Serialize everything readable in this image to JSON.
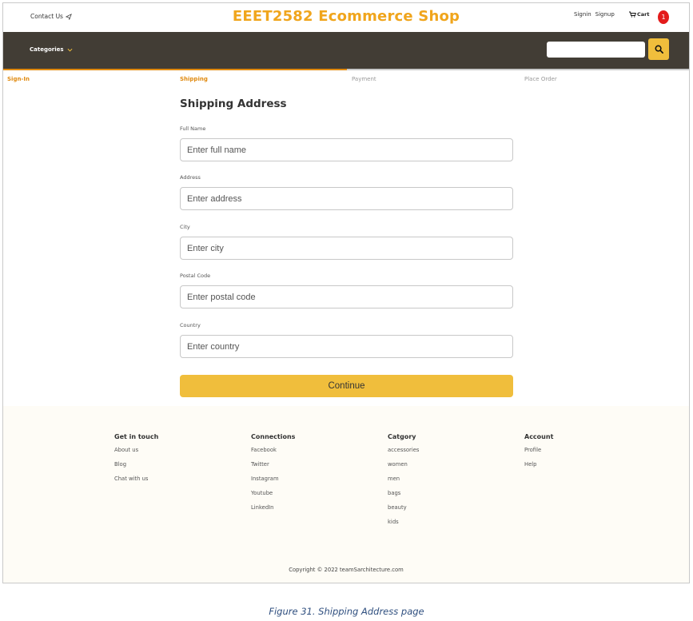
{
  "header": {
    "contact_label": "Contact Us",
    "brand": "EEET2582 Ecommerce Shop",
    "signin_label": "Signin",
    "signup_label": "Signup",
    "cart_label": "Cart",
    "cart_count": "1"
  },
  "nav": {
    "categories_label": "Categories",
    "search_placeholder": ""
  },
  "steps": [
    {
      "label": "Sign-In",
      "active": true
    },
    {
      "label": "Shipping",
      "active": true
    },
    {
      "label": "Payment",
      "active": false
    },
    {
      "label": "Place Order",
      "active": false
    }
  ],
  "form": {
    "title": "Shipping Address",
    "fields": [
      {
        "label": "Full Name",
        "placeholder": "Enter full name",
        "value": ""
      },
      {
        "label": "Address",
        "placeholder": "Enter address",
        "value": ""
      },
      {
        "label": "City",
        "placeholder": "Enter city",
        "value": ""
      },
      {
        "label": "Postal Code",
        "placeholder": "Enter postal code",
        "value": ""
      },
      {
        "label": "Country",
        "placeholder": "Enter country",
        "value": ""
      }
    ],
    "submit_label": "Continue"
  },
  "footer": {
    "columns": [
      {
        "title": "Get in touch",
        "items": [
          "About us",
          "Blog",
          "Chat with us"
        ]
      },
      {
        "title": "Connections",
        "items": [
          "Facebook",
          "Twitter",
          "Instagram",
          "Youtube",
          "LinkedIn"
        ]
      },
      {
        "title": "Catgory",
        "items": [
          "accessories",
          "women",
          "men",
          "bags",
          "beauty",
          "kids"
        ]
      },
      {
        "title": "Account",
        "items": [
          "Profile",
          "Help"
        ]
      }
    ],
    "copyright": "Copyright © 2022 teamSarchitecture.com"
  },
  "caption": "Figure 31. Shipping Address page",
  "colors": {
    "brand": "#f0a51c",
    "nav_bg": "#423d35",
    "accent_button": "#f0be3c",
    "active_step": "#e08a10",
    "badge": "#e31b1b"
  }
}
